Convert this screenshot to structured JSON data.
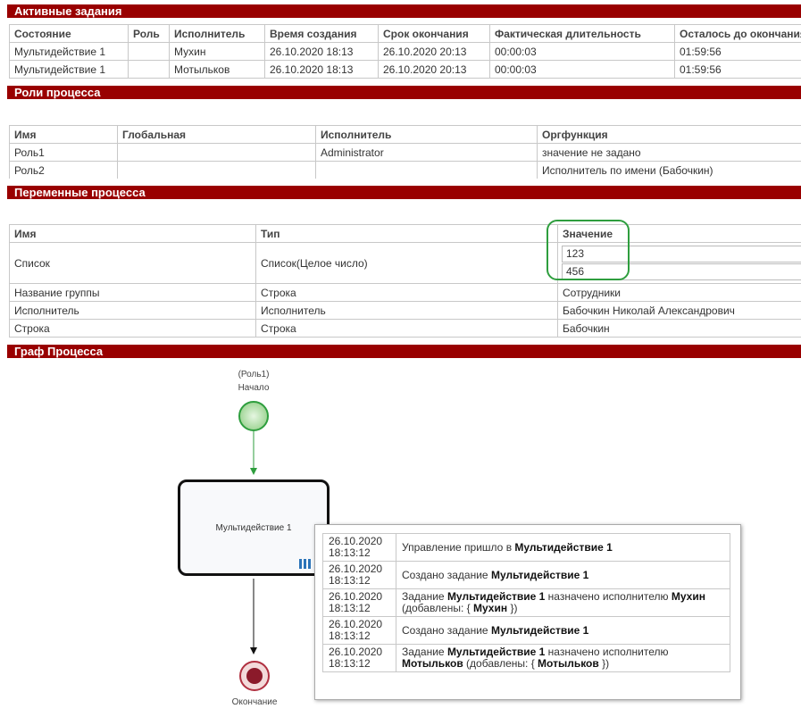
{
  "sections": {
    "active_tasks": "Активные задания",
    "roles": "Роли процесса",
    "variables": "Переменные процесса",
    "graph": "Граф Процесса"
  },
  "active_tasks": {
    "columns": [
      "Состояние",
      "Роль",
      "Исполнитель",
      "Время создания",
      "Срок окончания",
      "Фактическая длительность",
      "Осталось до окончания"
    ],
    "rows": [
      [
        "Мультидействие 1",
        "",
        "Мухин",
        "26.10.2020 18:13",
        "26.10.2020 20:13",
        "00:00:03",
        "01:59:56"
      ],
      [
        "Мультидействие 1",
        "",
        "Мотыльков",
        "26.10.2020 18:13",
        "26.10.2020 20:13",
        "00:00:03",
        "01:59:56"
      ]
    ]
  },
  "roles": {
    "columns": [
      "Имя",
      "Глобальная",
      "Исполнитель",
      "Оргфункция"
    ],
    "rows": [
      [
        "Роль1",
        "",
        "Administrator",
        "значение не задано"
      ],
      [
        "Роль2",
        "",
        "",
        "Исполнитель по имени (Бабочкин)"
      ]
    ]
  },
  "variables": {
    "columns": [
      "Имя",
      "Тип",
      "Значение"
    ],
    "list_row": {
      "name": "Список",
      "type": "Список(Целое число)",
      "values": [
        "123",
        "456"
      ]
    },
    "rows": [
      [
        "Название группы",
        "Строка",
        "Сотрудники"
      ],
      [
        "Исполнитель",
        "Исполнитель",
        "Бабочкин Николай Александрович"
      ],
      [
        "Строка",
        "Строка",
        "Бабочкин"
      ]
    ]
  },
  "graph": {
    "start_role": "(Роль1)",
    "start_label": "Начало",
    "task_label": "Мультидействие 1",
    "end_label": "Окончание"
  },
  "log": [
    {
      "date": "26.10.2020",
      "time": "18:13:12",
      "parts": [
        {
          "t": "Управление пришло в "
        },
        {
          "t": "Мультидействие 1",
          "b": true
        }
      ]
    },
    {
      "date": "26.10.2020",
      "time": "18:13:12",
      "parts": [
        {
          "t": "Создано задание "
        },
        {
          "t": "Мультидействие 1",
          "b": true
        }
      ]
    },
    {
      "date": "26.10.2020",
      "time": "18:13:12",
      "parts": [
        {
          "t": "Задание "
        },
        {
          "t": "Мультидействие 1",
          "b": true
        },
        {
          "t": " назначено исполнителю "
        },
        {
          "t": "Мухин",
          "b": true
        },
        {
          "t": " (добавлены: { "
        },
        {
          "t": "Мухин",
          "b": true
        },
        {
          "t": " })"
        }
      ]
    },
    {
      "date": "26.10.2020",
      "time": "18:13:12",
      "parts": [
        {
          "t": "Создано задание "
        },
        {
          "t": "Мультидействие 1",
          "b": true
        }
      ]
    },
    {
      "date": "26.10.2020",
      "time": "18:13:12",
      "parts": [
        {
          "t": "Задание "
        },
        {
          "t": "Мультидействие 1",
          "b": true
        },
        {
          "t": " назначено исполнителю "
        },
        {
          "t": "Мотыльков",
          "b": true
        },
        {
          "t": " (добавлены: { "
        },
        {
          "t": "Мотыльков",
          "b": true
        },
        {
          "t": " })"
        }
      ]
    }
  ],
  "colors": {
    "header": "#990000",
    "start_fill": "#a8dca0",
    "start_stroke": "#2e9e3e",
    "end_fill": "#8b1a2a",
    "highlight": "#2e9e3e"
  }
}
